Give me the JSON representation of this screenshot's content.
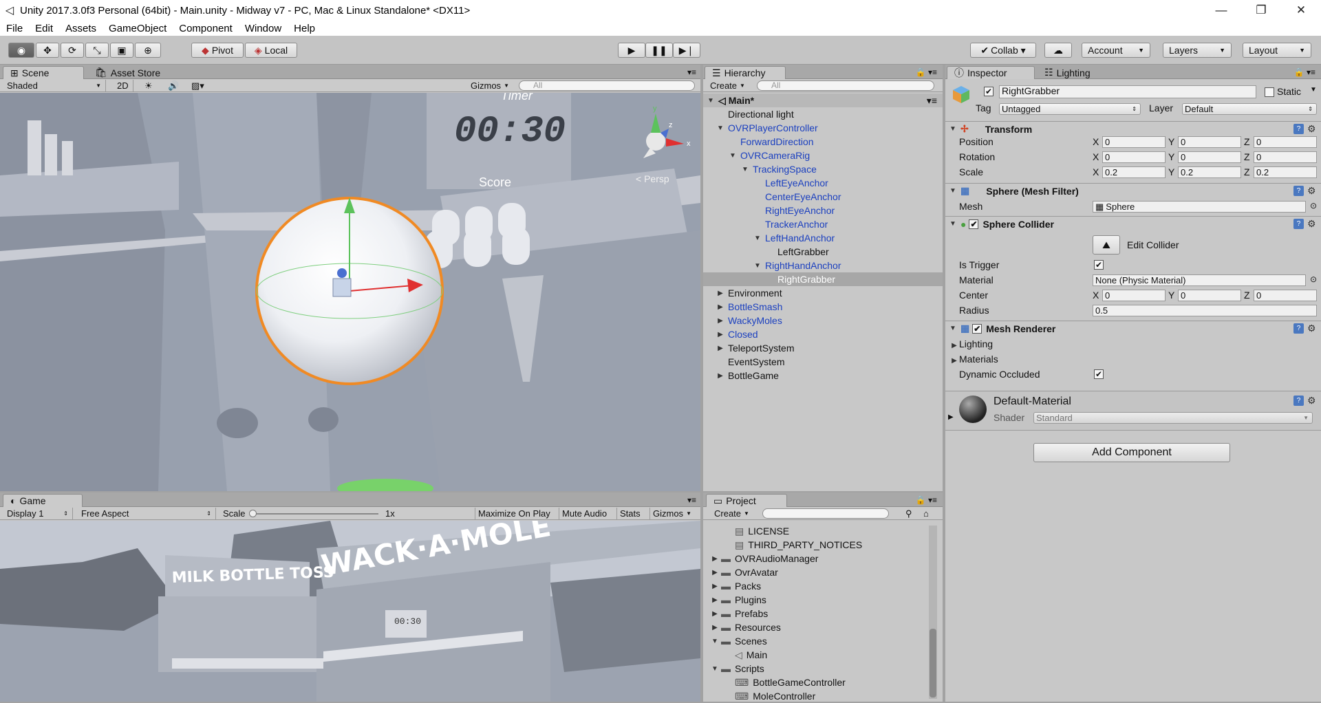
{
  "window": {
    "title": "Unity 2017.3.0f3 Personal (64bit) - Main.unity - Midway v7 - PC, Mac & Linux Standalone* <DX11>",
    "minimize": "—",
    "restore": "❐",
    "close": "✕"
  },
  "menu": [
    "File",
    "Edit",
    "Assets",
    "GameObject",
    "Component",
    "Window",
    "Help"
  ],
  "toolbar": {
    "pivot": "Pivot",
    "local": "Local",
    "play_icon": "▶",
    "pause_icon": "❚❚",
    "step_icon": "▶❘",
    "collab": "Collab ▾",
    "account": "Account",
    "layers": "Layers",
    "layout": "Layout"
  },
  "scene": {
    "tab_scene": "Scene",
    "tab_asset_store": "Asset Store",
    "shading": "Shaded",
    "mode_2d": "2D",
    "gizmos": "Gizmos",
    "search_placeholder": "All",
    "persp": "< Persp",
    "axis_x": "x",
    "axis_y": "y",
    "axis_z": "z",
    "timer_label": "Timer",
    "timer_value": "00:30",
    "score_label": "Score"
  },
  "game": {
    "tab": "Game",
    "display": "Display 1",
    "aspect": "Free Aspect",
    "scale_label": "Scale",
    "scale_value": "1x",
    "maximize": "Maximize On Play",
    "mute": "Mute Audio",
    "stats": "Stats",
    "gizmos": "Gizmos",
    "sign_milk": "MILK BOTTLE TOSS",
    "sign_wack": "WACK·A·MOLE",
    "timer_value": "00:30"
  },
  "hierarchy": {
    "tab": "Hierarchy",
    "create": "Create",
    "search_placeholder": "All",
    "scene_name": "Main*",
    "items": [
      {
        "label": "Directional light",
        "indent": 0,
        "arrow": "",
        "blue": false,
        "selected": false
      },
      {
        "label": "OVRPlayerController",
        "indent": 0,
        "arrow": "▼",
        "blue": true,
        "selected": false
      },
      {
        "label": "ForwardDirection",
        "indent": 1,
        "arrow": "",
        "blue": true,
        "selected": false
      },
      {
        "label": "OVRCameraRig",
        "indent": 1,
        "arrow": "▼",
        "blue": true,
        "selected": false
      },
      {
        "label": "TrackingSpace",
        "indent": 2,
        "arrow": "▼",
        "blue": true,
        "selected": false
      },
      {
        "label": "LeftEyeAnchor",
        "indent": 3,
        "arrow": "",
        "blue": true,
        "selected": false
      },
      {
        "label": "CenterEyeAnchor",
        "indent": 3,
        "arrow": "",
        "blue": true,
        "selected": false
      },
      {
        "label": "RightEyeAnchor",
        "indent": 3,
        "arrow": "",
        "blue": true,
        "selected": false
      },
      {
        "label": "TrackerAnchor",
        "indent": 3,
        "arrow": "",
        "blue": true,
        "selected": false
      },
      {
        "label": "LeftHandAnchor",
        "indent": 3,
        "arrow": "▼",
        "blue": true,
        "selected": false
      },
      {
        "label": "LeftGrabber",
        "indent": 4,
        "arrow": "",
        "blue": false,
        "selected": false
      },
      {
        "label": "RightHandAnchor",
        "indent": 3,
        "arrow": "▼",
        "blue": true,
        "selected": false
      },
      {
        "label": "RightGrabber",
        "indent": 4,
        "arrow": "",
        "blue": false,
        "selected": true
      },
      {
        "label": "Environment",
        "indent": 0,
        "arrow": "▶",
        "blue": false,
        "selected": false
      },
      {
        "label": "BottleSmash",
        "indent": 0,
        "arrow": "▶",
        "blue": true,
        "selected": false
      },
      {
        "label": "WackyMoles",
        "indent": 0,
        "arrow": "▶",
        "blue": true,
        "selected": false
      },
      {
        "label": "Closed",
        "indent": 0,
        "arrow": "▶",
        "blue": true,
        "selected": false
      },
      {
        "label": "TeleportSystem",
        "indent": 0,
        "arrow": "▶",
        "blue": false,
        "selected": false
      },
      {
        "label": "EventSystem",
        "indent": 0,
        "arrow": "",
        "blue": false,
        "selected": false
      },
      {
        "label": "BottleGame",
        "indent": 0,
        "arrow": "▶",
        "blue": false,
        "selected": false
      }
    ]
  },
  "project": {
    "tab": "Project",
    "create": "Create",
    "items": [
      {
        "label": "LICENSE",
        "type": "file",
        "indent": 1,
        "arrow": ""
      },
      {
        "label": "THIRD_PARTY_NOTICES",
        "type": "file",
        "indent": 1,
        "arrow": ""
      },
      {
        "label": "OVRAudioManager",
        "type": "folder",
        "indent": 0,
        "arrow": "▶"
      },
      {
        "label": "OvrAvatar",
        "type": "folder",
        "indent": 0,
        "arrow": "▶"
      },
      {
        "label": "Packs",
        "type": "folder",
        "indent": 0,
        "arrow": "▶"
      },
      {
        "label": "Plugins",
        "type": "folder",
        "indent": 0,
        "arrow": "▶"
      },
      {
        "label": "Prefabs",
        "type": "folder",
        "indent": 0,
        "arrow": "▶"
      },
      {
        "label": "Resources",
        "type": "folder",
        "indent": 0,
        "arrow": "▶"
      },
      {
        "label": "Scenes",
        "type": "folder",
        "indent": 0,
        "arrow": "▼"
      },
      {
        "label": "Main",
        "type": "scene",
        "indent": 1,
        "arrow": ""
      },
      {
        "label": "Scripts",
        "type": "folder",
        "indent": 0,
        "arrow": "▼"
      },
      {
        "label": "BottleGameController",
        "type": "script",
        "indent": 1,
        "arrow": ""
      },
      {
        "label": "MoleController",
        "type": "script",
        "indent": 1,
        "arrow": ""
      }
    ]
  },
  "inspector": {
    "tab": "Inspector",
    "tab_lighting": "Lighting",
    "object_name": "RightGrabber",
    "static_label": "Static",
    "tag_label": "Tag",
    "tag_value": "Untagged",
    "layer_label": "Layer",
    "layer_value": "Default",
    "transform": {
      "title": "Transform",
      "position_label": "Position",
      "rotation_label": "Rotation",
      "scale_label": "Scale",
      "position": [
        "0",
        "0",
        "0"
      ],
      "rotation": [
        "0",
        "0",
        "0"
      ],
      "scale": [
        "0.2",
        "0.2",
        "0.2"
      ]
    },
    "axes": [
      "X",
      "Y",
      "Z"
    ],
    "mesh_filter": {
      "title": "Sphere (Mesh Filter)",
      "mesh_label": "Mesh",
      "mesh_value": "Sphere"
    },
    "sphere_collider": {
      "title": "Sphere Collider",
      "edit_collider": "Edit Collider",
      "is_trigger_label": "Is Trigger",
      "material_label": "Material",
      "material_value": "None (Physic Material)",
      "center_label": "Center",
      "center": [
        "0",
        "0",
        "0"
      ],
      "radius_label": "Radius",
      "radius_value": "0.5"
    },
    "mesh_renderer": {
      "title": "Mesh Renderer",
      "lighting": "Lighting",
      "materials": "Materials",
      "dynamic_occluded": "Dynamic Occluded"
    },
    "material": {
      "name": "Default-Material",
      "shader_label": "Shader",
      "shader_value": "Standard"
    },
    "add_component": "Add Component"
  },
  "colors": {
    "selection_orange": "#f08a24",
    "prefab_blue": "#1a3fbf",
    "editor_gray": "#c8c8c8"
  }
}
